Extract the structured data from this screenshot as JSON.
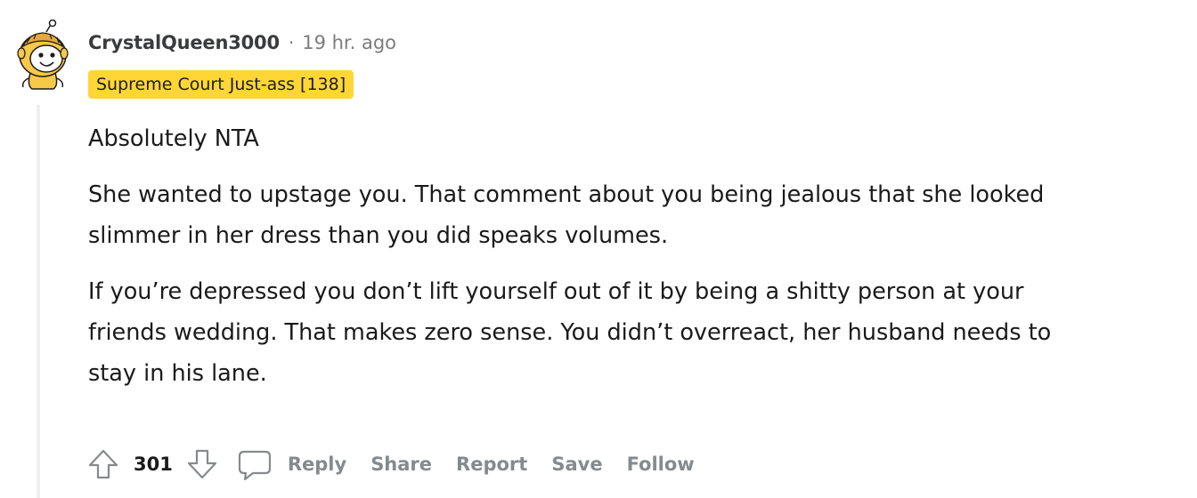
{
  "comment": {
    "author": "CrystalQueen3000",
    "separator": "·",
    "time_ago": "19 hr. ago",
    "flair": "Supreme Court Just-ass [138]",
    "flair_color": "#ffd635",
    "paragraphs": [
      [
        "Absolutely NTA"
      ],
      [
        "She wanted to upstage you. That comment about you being jealous that she looked",
        "slimmer in her dress than you did speaks volumes."
      ],
      [
        "If you’re depressed you don’t lift yourself out of it by being a shitty person at your",
        "friends wedding. That makes zero sense. You didn’t overreact, her husband needs to",
        "stay in his lane."
      ]
    ]
  },
  "actions": {
    "upvote_icon": "arrow-up-icon",
    "score": "301",
    "downvote_icon": "arrow-down-icon",
    "comment_icon": "speech-bubble-icon",
    "reply": "Reply",
    "share": "Share",
    "report": "Report",
    "save": "Save",
    "follow": "Follow"
  }
}
